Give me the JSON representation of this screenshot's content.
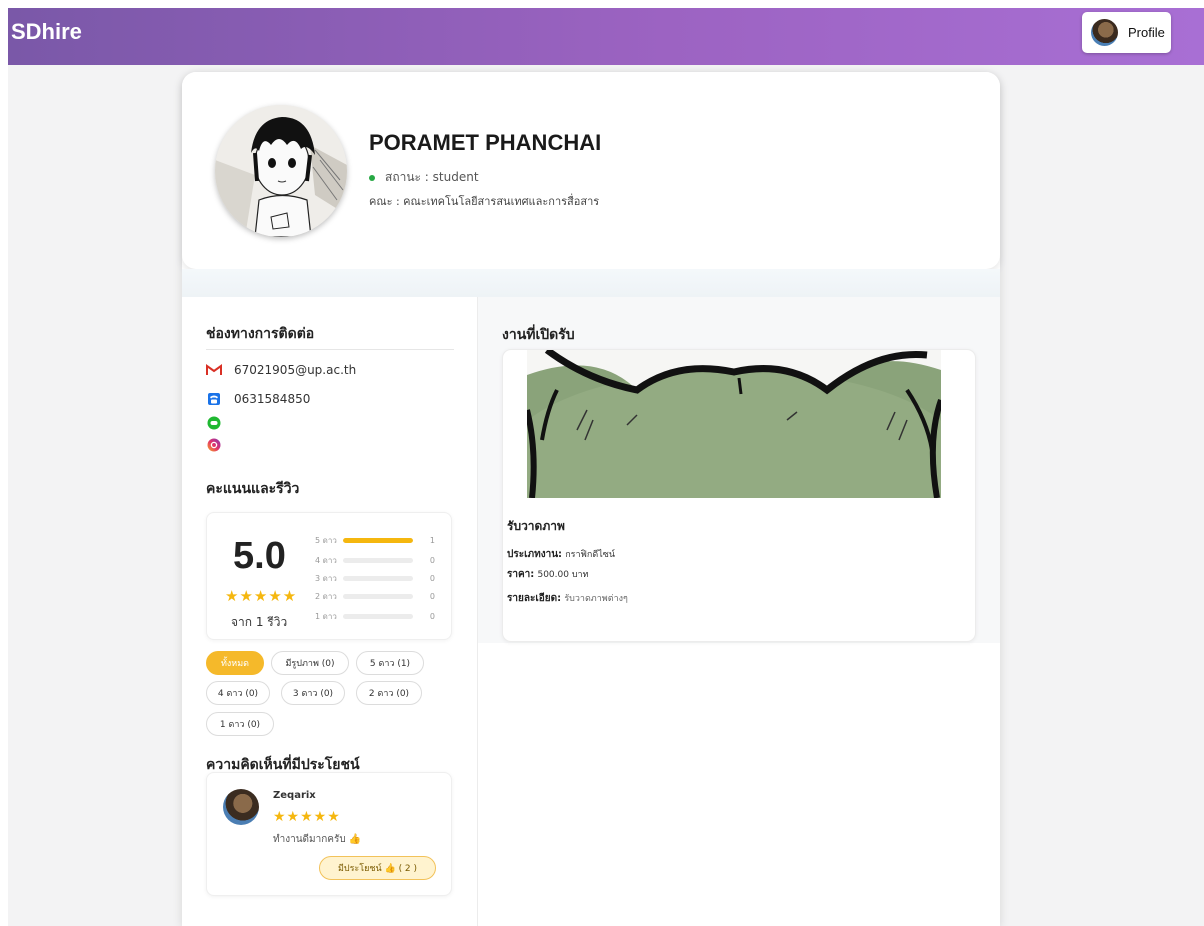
{
  "navbar": {
    "brand": "SDhire",
    "profile_label": "Profile"
  },
  "profile": {
    "name": "PORAMET PHANCHAI",
    "status": "สถานะ : student",
    "faculty": "คณะ : คณะเทคโนโลยีสารสนเทศและการสื่อสาร"
  },
  "contact": {
    "title": "ช่องทางการติดต่อ",
    "email": "67021905@up.ac.th",
    "phone": "0631584850"
  },
  "ratings": {
    "title": "คะแนนและรีวิว",
    "score": "5.0",
    "stars": "★★★★★",
    "count_text": "จาก 1 รีวิว",
    "breakdown": [
      {
        "label": "5 ดาว",
        "count": "1",
        "fraction": 1.0
      },
      {
        "label": "4 ดาว",
        "count": "0",
        "fraction": 0
      },
      {
        "label": "3 ดาว",
        "count": "0",
        "fraction": 0
      },
      {
        "label": "2 ดาว",
        "count": "0",
        "fraction": 0
      },
      {
        "label": "1 ดาว",
        "count": "0",
        "fraction": 0
      }
    ]
  },
  "filters": [
    {
      "label": "ทั้งหมด",
      "active": true
    },
    {
      "label": "มีรูปภาพ (0)",
      "active": false
    },
    {
      "label": "5 ดาว (1)",
      "active": false
    },
    {
      "label": "4 ดาว (0)",
      "active": false
    },
    {
      "label": "3 ดาว (0)",
      "active": false
    },
    {
      "label": "2 ดาว (0)",
      "active": false
    },
    {
      "label": "1 ดาว (0)",
      "active": false
    }
  ],
  "reviews": {
    "title": "ความคิดเห็นที่มีประโยชน์",
    "items": [
      {
        "name": "Zeqarix",
        "stars": "★★★★★",
        "text": "ทำงานดีมากครับ 👍",
        "helpful": "มีประโยชน์ 👍 ( 2 )"
      }
    ]
  },
  "jobs": {
    "title": "งานที่เปิดรับ",
    "items": [
      {
        "title": "รับวาดภาพ",
        "type_label": "ประเภทงาน:",
        "type_value": "กราฟิกดีไซน์",
        "price_label": "ราคา:",
        "price_value": "500.00 บาท",
        "detail_label": "รายละเอียด:",
        "detail_value": "รับวาดภาพต่างๆ"
      }
    ]
  },
  "colors": {
    "nav_gradient_start": "#7a58a8",
    "nav_gradient_end": "#a86fd4",
    "accent_yellow": "#f5b70f",
    "status_green": "#27a844"
  },
  "icons": {
    "email": "gmail-icon",
    "phone": "phone-icon",
    "line": "line-icon",
    "instagram": "instagram-icon"
  }
}
